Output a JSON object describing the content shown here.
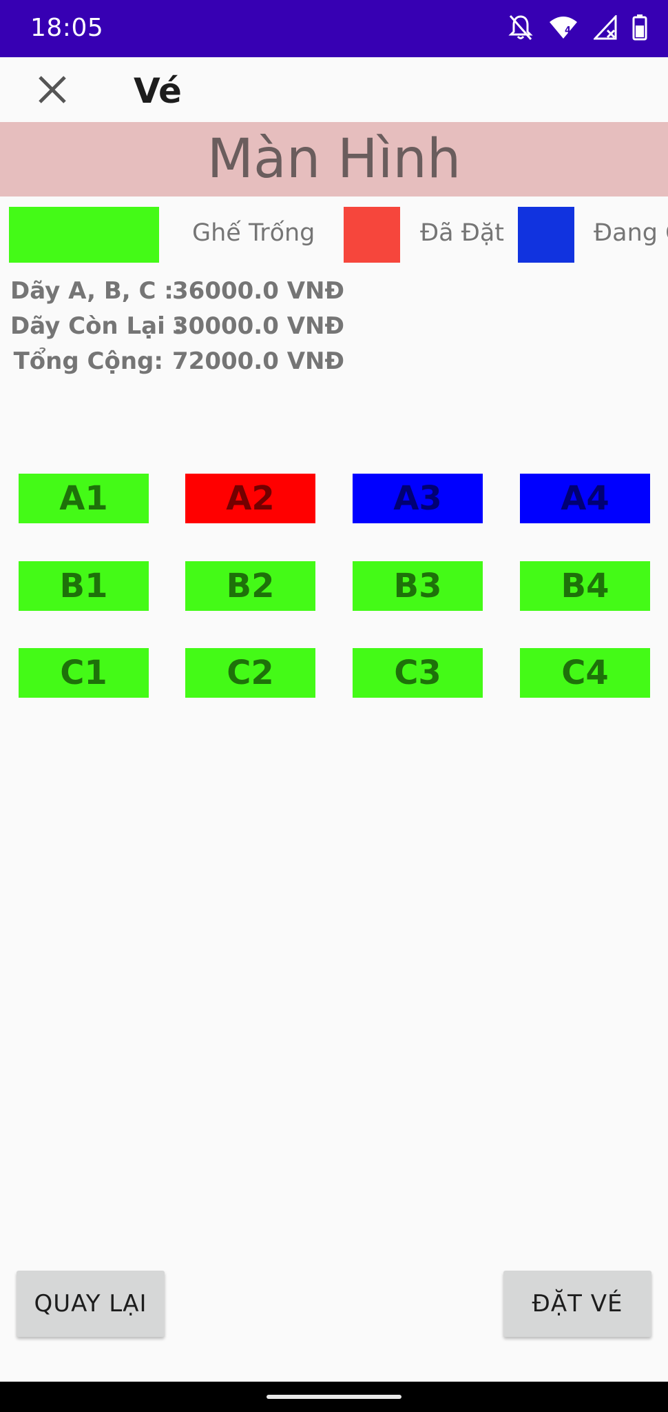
{
  "status_bar": {
    "time": "18:05",
    "icons": [
      "notifications-off-icon",
      "wifi-icon",
      "signal-icon",
      "battery-icon"
    ],
    "wifi_badge": "4"
  },
  "app_bar": {
    "close_icon": "close-icon",
    "title": "Vé"
  },
  "screen_banner": {
    "label": "Màn Hình"
  },
  "legend": [
    {
      "label": "Ghế Trống",
      "color": "#44fa17"
    },
    {
      "label": "Đã Đặt",
      "color": "#f6463c"
    },
    {
      "label": "Đang C",
      "color": "#1133df"
    }
  ],
  "prices": [
    {
      "label": "Dãy A, B, C :",
      "value": "36000.0 VNĐ"
    },
    {
      "label": "Dãy Còn Lại :",
      "value": "30000.0 VNĐ"
    },
    {
      "label": "Tổng Cộng:",
      "value": "72000.0 VNĐ"
    }
  ],
  "seat_status_colors": {
    "available": "#44fa17",
    "booked": "#ff0000",
    "selected": "#0000ff"
  },
  "seats": [
    {
      "label": "A1",
      "status": "available"
    },
    {
      "label": "A2",
      "status": "booked"
    },
    {
      "label": "A3",
      "status": "selected"
    },
    {
      "label": "A4",
      "status": "selected"
    },
    {
      "label": "B1",
      "status": "available"
    },
    {
      "label": "B2",
      "status": "available"
    },
    {
      "label": "B3",
      "status": "available"
    },
    {
      "label": "B4",
      "status": "available"
    },
    {
      "label": "C1",
      "status": "available"
    },
    {
      "label": "C2",
      "status": "available"
    },
    {
      "label": "C3",
      "status": "available"
    },
    {
      "label": "C4",
      "status": "available"
    }
  ],
  "buttons": {
    "back": "QUAY LẠI",
    "book": "ĐẶT VÉ"
  }
}
